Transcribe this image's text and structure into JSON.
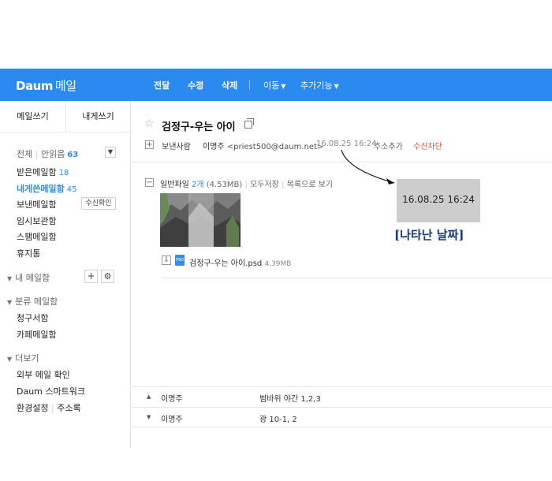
{
  "header": {
    "logo_brand": "Daum",
    "logo_service": "메일",
    "actions": {
      "forward": "전달",
      "edit": "수정",
      "delete": "삭제",
      "move": "이동",
      "more": "추가기능"
    }
  },
  "sidebar": {
    "write_mail": "메일쓰기",
    "write_self": "내게쓰기",
    "summary": {
      "all": "전체",
      "unread": "안읽음",
      "unread_count": "63"
    },
    "folders": [
      {
        "label": "받은메일함",
        "count": "18"
      },
      {
        "label": "내게쓴메일함",
        "count": "45"
      },
      {
        "label": "보낸메일함",
        "badge": "수신확인"
      },
      {
        "label": "임시보관함"
      },
      {
        "label": "스팸메일함"
      },
      {
        "label": "휴지통"
      }
    ],
    "my_mailbox": "내 메일함",
    "category": {
      "title": "분류 메일함",
      "items": [
        "청구서함",
        "카페메일함"
      ]
    },
    "more": {
      "title": "더보기",
      "items": [
        "외부 메일 확인",
        "Daum 스마트워크"
      ],
      "settings": "환경설정",
      "contacts": "주소록"
    }
  },
  "message": {
    "subject": "검정구-우는 아이",
    "sender_label": "보낸사람",
    "sender_name": "이명주",
    "sender_email": "<priest500@daum.net>",
    "date": "16.08.25 16:24",
    "add_contact": "주소추가",
    "block": "수신차단",
    "attachments": {
      "label": "일반파일",
      "count": "2개",
      "size": "(4.53MB)",
      "save_all": "모두저장",
      "list_view": "목록으로 보기",
      "file": {
        "name": "검정구-우는 아이.psd",
        "size": "4.39MB",
        "type": "PSD"
      }
    }
  },
  "annotation": {
    "zoom_date": "16.08.25 16:24",
    "label": "[나타난 날짜]"
  },
  "list": [
    {
      "direction": "up",
      "sender": "이명주",
      "subject": "범바위 야간 1,2,3"
    },
    {
      "direction": "down",
      "sender": "이명주",
      "subject": "광 10-1, 2"
    }
  ],
  "colors": {
    "accent": "#2b8af0",
    "annotation": "#1a3a7a",
    "block": "#e0533b"
  }
}
